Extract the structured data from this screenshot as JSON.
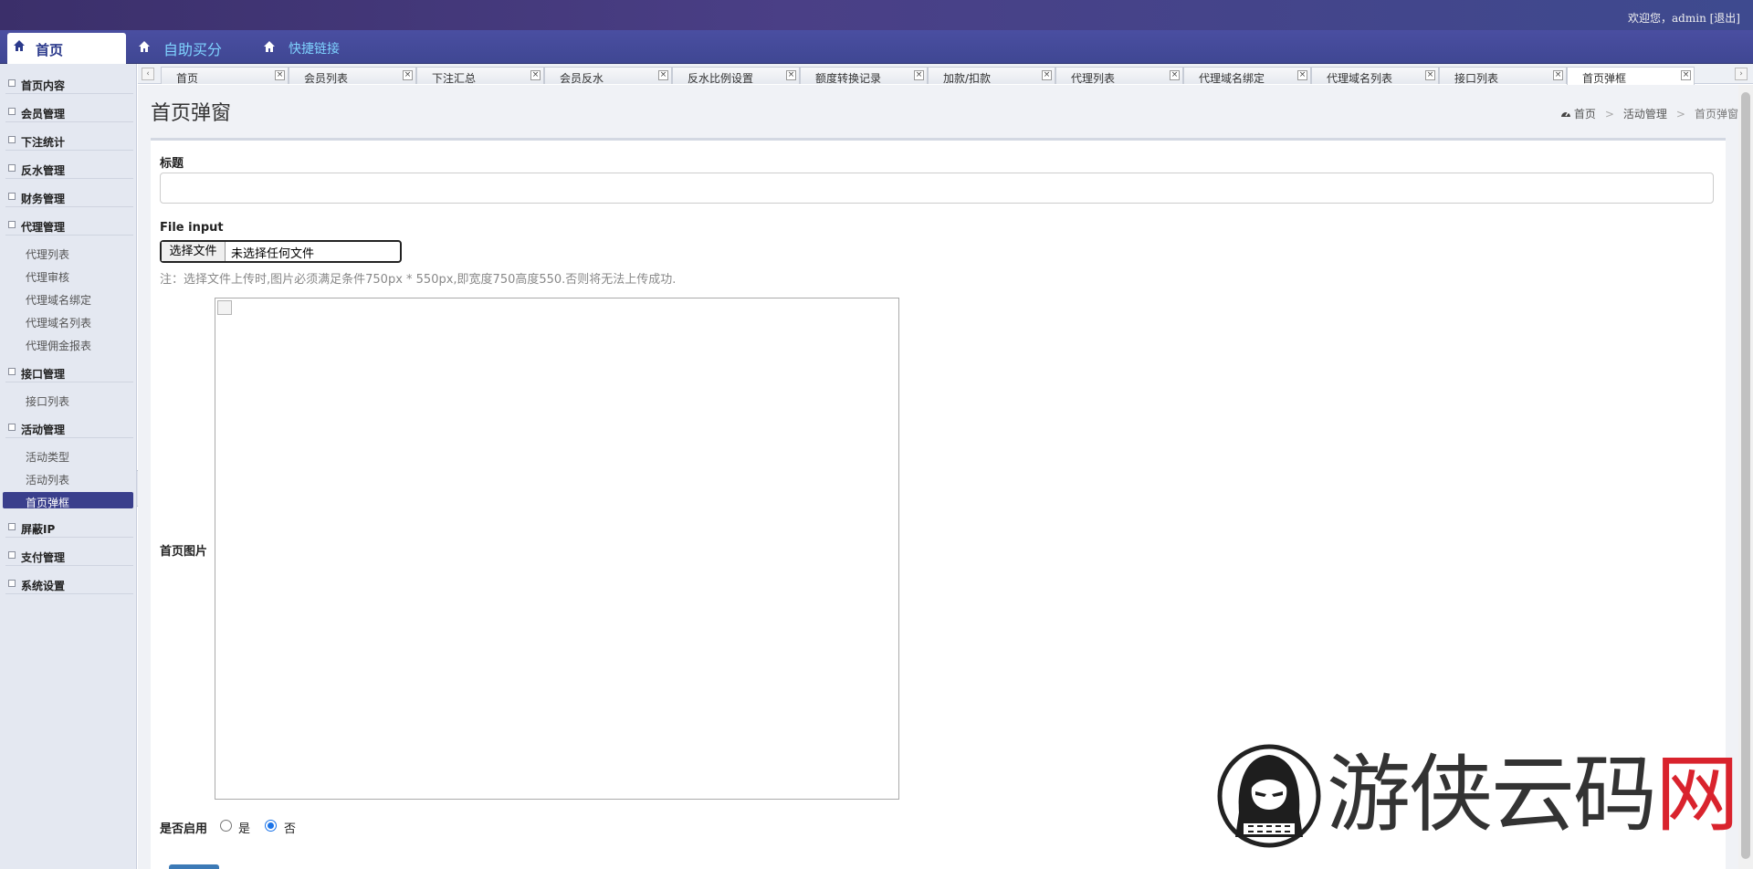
{
  "header": {
    "welcome_text": "欢迎您，admin [退出]"
  },
  "nav": {
    "home_label": "首页",
    "links": [
      {
        "label": "自助买分",
        "icon": "home-icon"
      },
      {
        "label": "快捷链接",
        "icon": "home-icon"
      }
    ]
  },
  "sidebar": {
    "groups": [
      {
        "label": "首页内容"
      },
      {
        "label": "会员管理"
      },
      {
        "label": "下注统计"
      },
      {
        "label": "反水管理"
      },
      {
        "label": "财务管理"
      },
      {
        "label": "代理管理",
        "items": [
          "代理列表",
          "代理审核",
          "代理域名绑定",
          "代理域名列表",
          "代理佣金报表"
        ]
      },
      {
        "label": "接口管理",
        "items": [
          "接口列表"
        ]
      },
      {
        "label": "活动管理",
        "items": [
          "活动类型",
          "活动列表",
          "首页弹框"
        ]
      },
      {
        "label": "屏蔽IP"
      },
      {
        "label": "支付管理"
      },
      {
        "label": "系统设置"
      }
    ],
    "active_item": "首页弹框"
  },
  "tabs": [
    "首页",
    "会员列表",
    "下注汇总",
    "会员反水",
    "反水比例设置",
    "额度转换记录",
    "加款/扣款",
    "代理列表",
    "代理域名绑定",
    "代理域名列表",
    "接口列表",
    "首页弹框"
  ],
  "page": {
    "title": "首页弹窗",
    "breadcrumb": [
      "首页",
      "活动管理",
      "首页弹窗"
    ]
  },
  "form": {
    "title_label": "标题",
    "title_value": "",
    "file_label": "File input",
    "file_button": "选择文件",
    "file_status": "未选择任何文件",
    "note": "注：选择文件上传时,图片必须满足条件750px * 550px,即宽度750高度550.否则将无法上传成功.",
    "image_label": "首页图片",
    "enable_label": "是否启用",
    "enable_options": [
      "是",
      "否"
    ],
    "enable_selected": "否"
  },
  "watermark": {
    "text": "游侠云码网"
  },
  "colors": {
    "accent": "#3a3f8c",
    "nav_link": "#7fd3ff",
    "radio_on": "#1a73e8"
  }
}
